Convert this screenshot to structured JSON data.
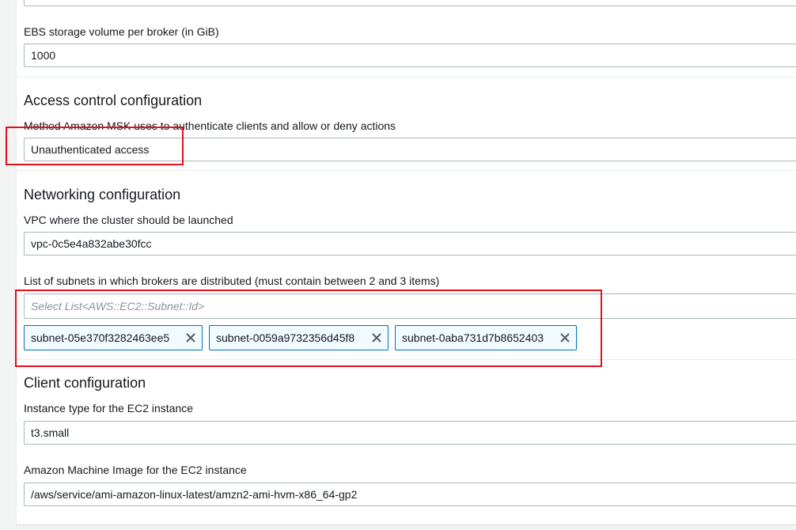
{
  "instance": {
    "ebs_label": "EBS storage volume per broker (in GiB)",
    "ebs_value": "1000"
  },
  "access_control": {
    "title": "Access control configuration",
    "method_label": "Method Amazon MSK uses to authenticate clients and allow or deny actions",
    "method_value": "Unauthenticated access"
  },
  "networking": {
    "title": "Networking configuration",
    "vpc_label": "VPC where the cluster should be launched",
    "vpc_value": "vpc-0c5e4a832abe30fcc",
    "subnets_label": "List of subnets in which brokers are distributed (must contain between 2 and 3 items)",
    "subnets_placeholder": "Select List<AWS::EC2::Subnet::Id>",
    "subnets": [
      "subnet-05e370f3282463ee5",
      "subnet-0059a9732356d45f8",
      "subnet-0aba731d7b8652403"
    ]
  },
  "client": {
    "title": "Client configuration",
    "instance_type_label": "Instance type for the EC2 instance",
    "instance_type_value": "t3.small",
    "ami_label": "Amazon Machine Image for the EC2 instance",
    "ami_value": "/aws/service/ami-amazon-linux-latest/amzn2-ami-hvm-x86_64-gp2"
  },
  "icons": {
    "remove_token": "close-icon"
  },
  "colors": {
    "highlight": "#e3101d",
    "token_border": "#0073bb",
    "token_bg": "#f1faff"
  }
}
